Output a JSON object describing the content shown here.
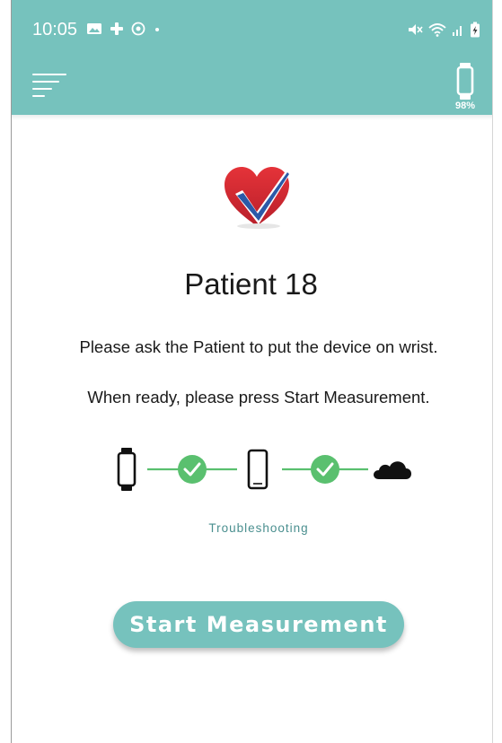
{
  "status_bar": {
    "time": "10:05",
    "left_icons": [
      "gallery-icon",
      "plus-icon",
      "target-icon",
      "dot-icon"
    ],
    "right_icons": [
      "mute-icon",
      "wifi-icon",
      "signal-icon",
      "battery-charging-icon"
    ]
  },
  "header": {
    "menu_icon": "hamburger-menu-icon",
    "device_icon": "smartwatch-icon",
    "device_battery": "98%",
    "background_color": "#76c2bd"
  },
  "logo": {
    "icon": "heart-checkmark-icon",
    "heart_color": "#d8282f",
    "check_color": "#2b59a8"
  },
  "patient_title": "Patient 18",
  "instructions": {
    "line1": "Please ask the Patient to put the device on wrist.",
    "line2": "When ready, please press Start Measurement."
  },
  "connection": {
    "nodes": [
      "smartwatch-icon",
      "smartphone-icon",
      "cloud-icon"
    ],
    "links": [
      {
        "status": "connected",
        "icon": "check-circle-icon"
      },
      {
        "status": "connected",
        "icon": "check-circle-icon"
      }
    ],
    "link_color": "#5ac06f"
  },
  "troubleshooting_link": "Troubleshooting",
  "start_button": "Start Measurement"
}
